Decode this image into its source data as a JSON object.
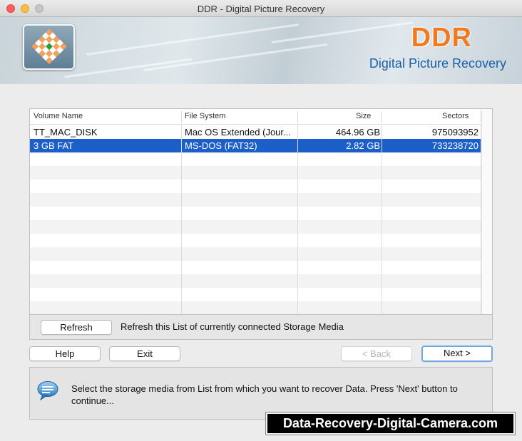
{
  "window": {
    "title": "DDR - Digital Picture Recovery"
  },
  "banner": {
    "brand": "DDR",
    "product": "Digital Picture Recovery"
  },
  "table": {
    "columns": [
      "Volume Name",
      "File System",
      "Size",
      "Sectors"
    ],
    "rows": [
      {
        "volume": "TT_MAC_DISK",
        "fs": "Mac OS Extended (Jour...",
        "size": "464.96  GB",
        "sectors": "975093952"
      },
      {
        "volume": "3 GB FAT",
        "fs": "MS-DOS (FAT32)",
        "size": "2.82  GB",
        "sectors": "733238720"
      }
    ],
    "selected_index": 1
  },
  "refresh": {
    "button": "Refresh",
    "description": "Refresh this List of currently connected Storage Media"
  },
  "nav": {
    "help": "Help",
    "exit": "Exit",
    "back": "< Back",
    "next": "Next >"
  },
  "message": {
    "text": "Select the storage media from List from which you want to recover Data. Press 'Next' button to continue..."
  },
  "watermark": "Data-Recovery-Digital-Camera.com",
  "colors": {
    "selection": "#1c5fc8",
    "brand_orange": "#f07a22",
    "brand_blue": "#1a5fa8"
  }
}
